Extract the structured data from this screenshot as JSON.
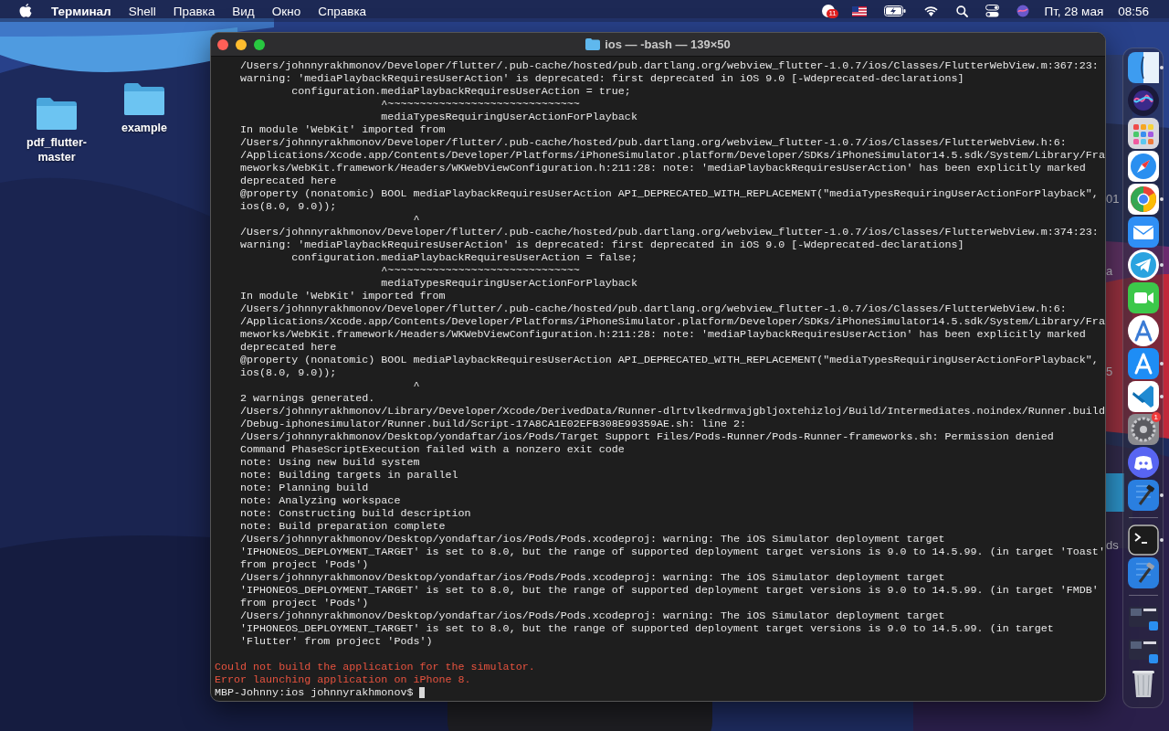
{
  "menu_bar": {
    "app_name": "Терминал",
    "menus": [
      "Shell",
      "Правка",
      "Вид",
      "Окно",
      "Справка"
    ],
    "notification_badge": "11",
    "date": "Пт, 28 мая",
    "time": "08:56"
  },
  "desktop_icons": [
    {
      "label": "pdf_flutter-master"
    },
    {
      "label": "example"
    }
  ],
  "background_window": {
    "fragments": [
      "01",
      "a",
      "5",
      "ds"
    ]
  },
  "terminal": {
    "title": "ios — -bash — 139×50",
    "lines": [
      {
        "kind": "output",
        "text": "    /Users/johnnyrakhmonov/Developer/flutter/.pub-cache/hosted/pub.dartlang.org/webview_flutter-1.0.7/ios/Classes/FlutterWebView.m:367:23:"
      },
      {
        "kind": "output",
        "text": "    warning: 'mediaPlaybackRequiresUserAction' is deprecated: first deprecated in iOS 9.0 [-Wdeprecated-declarations]"
      },
      {
        "kind": "output",
        "text": "            configuration.mediaPlaybackRequiresUserAction = true;"
      },
      {
        "kind": "output",
        "text": "                          ^~~~~~~~~~~~~~~~~~~~~~~~~~~~~~~"
      },
      {
        "kind": "output",
        "text": "                          mediaTypesRequiringUserActionForPlayback"
      },
      {
        "kind": "output",
        "text": "    In module 'WebKit' imported from"
      },
      {
        "kind": "output",
        "text": "    /Users/johnnyrakhmonov/Developer/flutter/.pub-cache/hosted/pub.dartlang.org/webview_flutter-1.0.7/ios/Classes/FlutterWebView.h:6:"
      },
      {
        "kind": "output",
        "text": "    /Applications/Xcode.app/Contents/Developer/Platforms/iPhoneSimulator.platform/Developer/SDKs/iPhoneSimulator14.5.sdk/System/Library/Fra"
      },
      {
        "kind": "output",
        "text": "    meworks/WebKit.framework/Headers/WKWebViewConfiguration.h:211:28: note: 'mediaPlaybackRequiresUserAction' has been explicitly marked"
      },
      {
        "kind": "output",
        "text": "    deprecated here"
      },
      {
        "kind": "output",
        "text": "    @property (nonatomic) BOOL mediaPlaybackRequiresUserAction API_DEPRECATED_WITH_REPLACEMENT(\"mediaTypesRequiringUserActionForPlayback\","
      },
      {
        "kind": "output",
        "text": "    ios(8.0, 9.0));"
      },
      {
        "kind": "output",
        "text": "                               ^"
      },
      {
        "kind": "output",
        "text": "    /Users/johnnyrakhmonov/Developer/flutter/.pub-cache/hosted/pub.dartlang.org/webview_flutter-1.0.7/ios/Classes/FlutterWebView.m:374:23:"
      },
      {
        "kind": "output",
        "text": "    warning: 'mediaPlaybackRequiresUserAction' is deprecated: first deprecated in iOS 9.0 [-Wdeprecated-declarations]"
      },
      {
        "kind": "output",
        "text": "            configuration.mediaPlaybackRequiresUserAction = false;"
      },
      {
        "kind": "output",
        "text": "                          ^~~~~~~~~~~~~~~~~~~~~~~~~~~~~~~"
      },
      {
        "kind": "output",
        "text": "                          mediaTypesRequiringUserActionForPlayback"
      },
      {
        "kind": "output",
        "text": "    In module 'WebKit' imported from"
      },
      {
        "kind": "output",
        "text": "    /Users/johnnyrakhmonov/Developer/flutter/.pub-cache/hosted/pub.dartlang.org/webview_flutter-1.0.7/ios/Classes/FlutterWebView.h:6:"
      },
      {
        "kind": "output",
        "text": "    /Applications/Xcode.app/Contents/Developer/Platforms/iPhoneSimulator.platform/Developer/SDKs/iPhoneSimulator14.5.sdk/System/Library/Fra"
      },
      {
        "kind": "output",
        "text": "    meworks/WebKit.framework/Headers/WKWebViewConfiguration.h:211:28: note: 'mediaPlaybackRequiresUserAction' has been explicitly marked"
      },
      {
        "kind": "output",
        "text": "    deprecated here"
      },
      {
        "kind": "output",
        "text": "    @property (nonatomic) BOOL mediaPlaybackRequiresUserAction API_DEPRECATED_WITH_REPLACEMENT(\"mediaTypesRequiringUserActionForPlayback\","
      },
      {
        "kind": "output",
        "text": "    ios(8.0, 9.0));"
      },
      {
        "kind": "output",
        "text": "                               ^"
      },
      {
        "kind": "output",
        "text": "    2 warnings generated."
      },
      {
        "kind": "output",
        "text": "    /Users/johnnyrakhmonov/Library/Developer/Xcode/DerivedData/Runner-dlrtvlkedrmvajgbljoxtehizloj/Build/Intermediates.noindex/Runner.build"
      },
      {
        "kind": "output",
        "text": "    /Debug-iphonesimulator/Runner.build/Script-17A8CA1E02EFB308E99359AE.sh: line 2:"
      },
      {
        "kind": "output",
        "text": "    /Users/johnnyrakhmonov/Desktop/yondaftar/ios/Pods/Target Support Files/Pods-Runner/Pods-Runner-frameworks.sh: Permission denied"
      },
      {
        "kind": "output",
        "text": "    Command PhaseScriptExecution failed with a nonzero exit code"
      },
      {
        "kind": "output",
        "text": "    note: Using new build system"
      },
      {
        "kind": "output",
        "text": "    note: Building targets in parallel"
      },
      {
        "kind": "output",
        "text": "    note: Planning build"
      },
      {
        "kind": "output",
        "text": "    note: Analyzing workspace"
      },
      {
        "kind": "output",
        "text": "    note: Constructing build description"
      },
      {
        "kind": "output",
        "text": "    note: Build preparation complete"
      },
      {
        "kind": "output",
        "text": "    /Users/johnnyrakhmonov/Desktop/yondaftar/ios/Pods/Pods.xcodeproj: warning: The iOS Simulator deployment target"
      },
      {
        "kind": "output",
        "text": "    'IPHONEOS_DEPLOYMENT_TARGET' is set to 8.0, but the range of supported deployment target versions is 9.0 to 14.5.99. (in target 'Toast'"
      },
      {
        "kind": "output",
        "text": "    from project 'Pods')"
      },
      {
        "kind": "output",
        "text": "    /Users/johnnyrakhmonov/Desktop/yondaftar/ios/Pods/Pods.xcodeproj: warning: The iOS Simulator deployment target"
      },
      {
        "kind": "output",
        "text": "    'IPHONEOS_DEPLOYMENT_TARGET' is set to 8.0, but the range of supported deployment target versions is 9.0 to 14.5.99. (in target 'FMDB'"
      },
      {
        "kind": "output",
        "text": "    from project 'Pods')"
      },
      {
        "kind": "output",
        "text": "    /Users/johnnyrakhmonov/Desktop/yondaftar/ios/Pods/Pods.xcodeproj: warning: The iOS Simulator deployment target"
      },
      {
        "kind": "output",
        "text": "    'IPHONEOS_DEPLOYMENT_TARGET' is set to 8.0, but the range of supported deployment target versions is 9.0 to 14.5.99. (in target"
      },
      {
        "kind": "output",
        "text": "    'Flutter' from project 'Pods')"
      },
      {
        "kind": "error",
        "text": "Could not build the application for the simulator."
      },
      {
        "kind": "error",
        "text": "Error launching application on iPhone 8."
      }
    ],
    "prompt": "MBP-Johnny:ios johnnyrakhmonov$ "
  },
  "dock": [
    {
      "kind": "finder",
      "running": true
    },
    {
      "kind": "siri",
      "running": false
    },
    {
      "kind": "launchpad",
      "running": false
    },
    {
      "kind": "safari",
      "running": false
    },
    {
      "kind": "chrome",
      "running": true
    },
    {
      "kind": "mail",
      "running": false
    },
    {
      "kind": "telegram",
      "running": true
    },
    {
      "kind": "facetime",
      "running": false
    },
    {
      "kind": "studio",
      "running": false
    },
    {
      "kind": "appstore",
      "running": true
    },
    {
      "kind": "vscode",
      "running": true
    },
    {
      "kind": "settings",
      "running": false,
      "badge": "1"
    },
    {
      "kind": "discord",
      "running": false
    },
    {
      "kind": "simulator",
      "running": true
    },
    {
      "kind": "separator"
    },
    {
      "kind": "terminal",
      "running": true
    },
    {
      "kind": "xcode",
      "running": false
    },
    {
      "kind": "separator"
    },
    {
      "kind": "thumbnail",
      "running": false
    },
    {
      "kind": "thumbnail",
      "running": false
    },
    {
      "kind": "trash",
      "running": false
    }
  ]
}
